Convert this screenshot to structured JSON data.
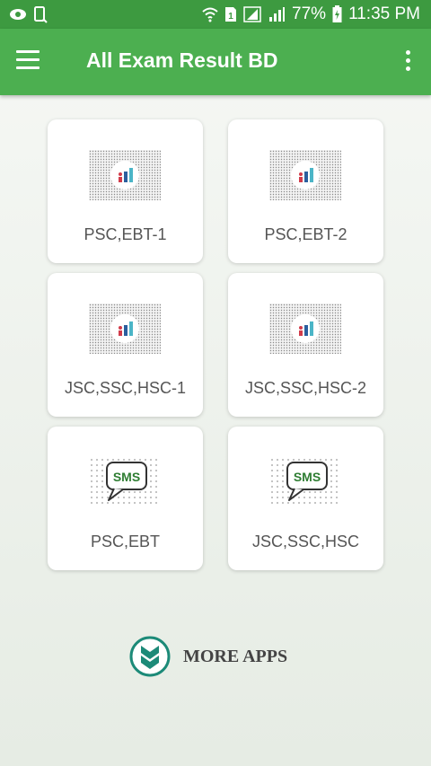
{
  "status_bar": {
    "battery": "77%",
    "time": "11:35 PM",
    "icons": [
      "messenger-icon",
      "device-icon",
      "wifi-icon",
      "sim1-icon",
      "signal-icon",
      "signal-icon-2",
      "battery-charging-icon"
    ]
  },
  "app_bar": {
    "title": "All Exam Result BD",
    "menu_icon": "hamburger-menu-icon",
    "overflow_icon": "more-vert-icon"
  },
  "cards": [
    {
      "label": "PSC,EBT-1",
      "icon": "chart-icon"
    },
    {
      "label": "PSC,EBT-2",
      "icon": "chart-icon"
    },
    {
      "label": "JSC,SSC,HSC-1",
      "icon": "chart-icon"
    },
    {
      "label": "JSC,SSC,HSC-2",
      "icon": "chart-icon"
    },
    {
      "label": "PSC,EBT",
      "icon": "sms-icon",
      "badge": "SMS"
    },
    {
      "label": "JSC,SSC,HSC",
      "icon": "sms-icon",
      "badge": "SMS"
    }
  ],
  "more_apps": {
    "label": "MORE APPS",
    "icon": "chevron-down-circle-icon"
  },
  "colors": {
    "status_bar": "#3d9a40",
    "app_bar": "#4caf50",
    "sms_green": "#2e7d32",
    "more_apps_teal": "#1c8a78"
  }
}
